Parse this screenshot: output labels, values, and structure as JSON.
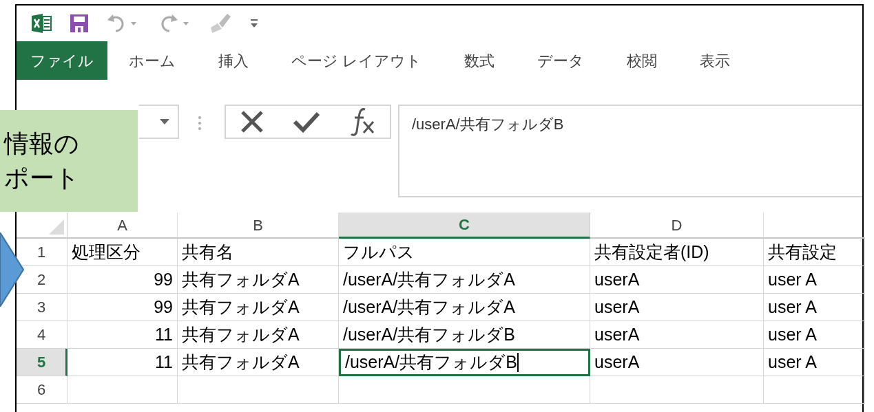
{
  "ribbon_tabs": [
    {
      "label": "ファイル",
      "selected": true
    },
    {
      "label": "ホーム",
      "selected": false
    },
    {
      "label": "挿入",
      "selected": false
    },
    {
      "label": "ページ レイアウト",
      "selected": false
    },
    {
      "label": "数式",
      "selected": false
    },
    {
      "label": "データ",
      "selected": false
    },
    {
      "label": "校閲",
      "selected": false
    },
    {
      "label": "表示",
      "selected": false
    }
  ],
  "formula_bar": {
    "value": "/userA/共有フォルダB"
  },
  "columns": [
    {
      "label": "A",
      "selected": false
    },
    {
      "label": "B",
      "selected": false
    },
    {
      "label": "C",
      "selected": true
    },
    {
      "label": "D",
      "selected": false
    }
  ],
  "rows": [
    {
      "number": "1",
      "selected": false,
      "cells": [
        {
          "text": "処理区分",
          "numeric": false
        },
        {
          "text": "共有名",
          "numeric": false
        },
        {
          "text": "フルパス",
          "numeric": false
        },
        {
          "text": "共有設定者(ID)",
          "numeric": false
        },
        {
          "text": "共有設定",
          "numeric": false
        }
      ]
    },
    {
      "number": "2",
      "selected": false,
      "cells": [
        {
          "text": "99",
          "numeric": true
        },
        {
          "text": "共有フォルダA",
          "numeric": false
        },
        {
          "text": "/userA/共有フォルダA",
          "numeric": false
        },
        {
          "text": "userA",
          "numeric": false
        },
        {
          "text": "user A",
          "numeric": false
        }
      ]
    },
    {
      "number": "3",
      "selected": false,
      "cells": [
        {
          "text": "99",
          "numeric": true
        },
        {
          "text": "共有フォルダA",
          "numeric": false
        },
        {
          "text": "/userA/共有フォルダA",
          "numeric": false
        },
        {
          "text": "userA",
          "numeric": false
        },
        {
          "text": "user A",
          "numeric": false
        }
      ]
    },
    {
      "number": "4",
      "selected": false,
      "cells": [
        {
          "text": "11",
          "numeric": true
        },
        {
          "text": "共有フォルダA",
          "numeric": false
        },
        {
          "text": "/userA/共有フォルダB",
          "numeric": false
        },
        {
          "text": "userA",
          "numeric": false
        },
        {
          "text": "user A",
          "numeric": false
        }
      ]
    },
    {
      "number": "5",
      "selected": true,
      "cells": [
        {
          "text": "11",
          "numeric": true
        },
        {
          "text": "共有フォルダA",
          "numeric": false
        },
        {
          "text": "/userA/共有フォルダB",
          "numeric": false
        },
        {
          "text": "userA",
          "numeric": false
        },
        {
          "text": "user A",
          "numeric": false
        }
      ]
    },
    {
      "number": "6",
      "selected": false,
      "cells": []
    }
  ],
  "callout": {
    "lines": [
      "情報の",
      "ポート"
    ]
  }
}
